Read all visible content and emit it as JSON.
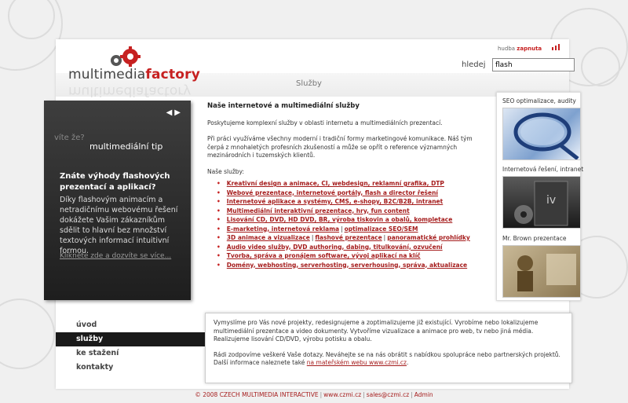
{
  "header": {
    "logo_prefix": "multimedia",
    "logo_suffix": "factory",
    "music_label": "hudba",
    "music_state": "zapnuta",
    "search_label": "hledej",
    "search_value": "flash",
    "section_title": "Služby"
  },
  "tip": {
    "kicker": "víte že?",
    "heading": "multimediální tip",
    "question": "Znáte výhody flashových prezentací a aplikací?",
    "body": "Díky flashovým animacím a netradičnímu webovému řešení dokážete Vašim zákazníkům sdělit to hlavní bez množství textových informací intuitivní formou.",
    "link": "Klikněte zde a dozvíte se více..."
  },
  "content": {
    "title": "Naše internetové a multimediální služby",
    "intro": "Poskytujeme komplexní služby v oblasti internetu a multimediálních prezentací.",
    "para2": "Při práci využíváme všechny moderní i tradiční formy marketingové komunikace. Náš tým čerpá z mnohaletých profesních zkušeností a může se opřít o reference významných mezinárodních i tuzemských klientů.",
    "services_label": "Naše služby:",
    "services": [
      [
        "Kreativní design a animace, CI, webdesign, reklamní grafika, DTP"
      ],
      [
        "Webové prezentace, internetové portály, flash a director řešení"
      ],
      [
        "Internetové aplikace a systémy, CMS, e-shopy, B2C/B2B, intranet"
      ],
      [
        "Multimediální interaktivní prezentace, hry, fun content"
      ],
      [
        "Lisování CD, DVD, HD DVD, BR, výroba tiskovin a obalů, kompletace"
      ],
      [
        "E-marketing, internetová reklama",
        "optimalizace SEO/SEM"
      ],
      [
        "3D animace a vizualizace",
        "flashové prezentace",
        "panoramatické prohlídky"
      ],
      [
        "Audio video služby, DVD authoring, dabing, titulkování, ozvučení"
      ],
      [
        "Tvorba, správa a pronájem software, vývoj aplikací na klíč"
      ],
      [
        "Domény, webhosting, serverhosting, serverhousing, správa, aktualizace"
      ]
    ]
  },
  "sidebar": [
    {
      "label": "SEO optimalizace, audity",
      "icon": "magnifier-image"
    },
    {
      "label": "Internetová řešení, intranet",
      "icon": "software-box-image"
    },
    {
      "label": "Mr. Brown prezentace",
      "icon": "brown-presentation-image"
    }
  ],
  "nav": {
    "items": [
      "úvod",
      "služby",
      "ke stažení",
      "kontakty"
    ],
    "active": "služby"
  },
  "bottom": {
    "para1": "Vymyslíme pro Vás nové projekty, redesignujeme a zoptimalizujeme již existující. Vyrobíme nebo lokalizujeme multimediální prezentace a video dokumenty. Vytvoříme vizualizace a animace pro web, tv nebo jiná média. Realizujeme lisování CD/DVD, výrobu potisku a obalu.",
    "para2_text": "Rádi zodpovíme veškeré Vaše dotazy. Neváhejte se na nás obrátit s nabídkou spolupráce nebo partnerských projektů. Další informace naleznete také",
    "para2_link": "na mateřském webu www.czmi.cz",
    "para2_end": "."
  },
  "footer": {
    "copyright": "© 2008 CZECH MULTIMEDIA INTERACTIVE",
    "site": "www.czmi.cz",
    "email": "sales@czmi.cz",
    "admin": "Admin"
  },
  "colors": {
    "accent": "#c62020",
    "dark_panel": "#2a2a2a",
    "link": "#a51c1c"
  }
}
